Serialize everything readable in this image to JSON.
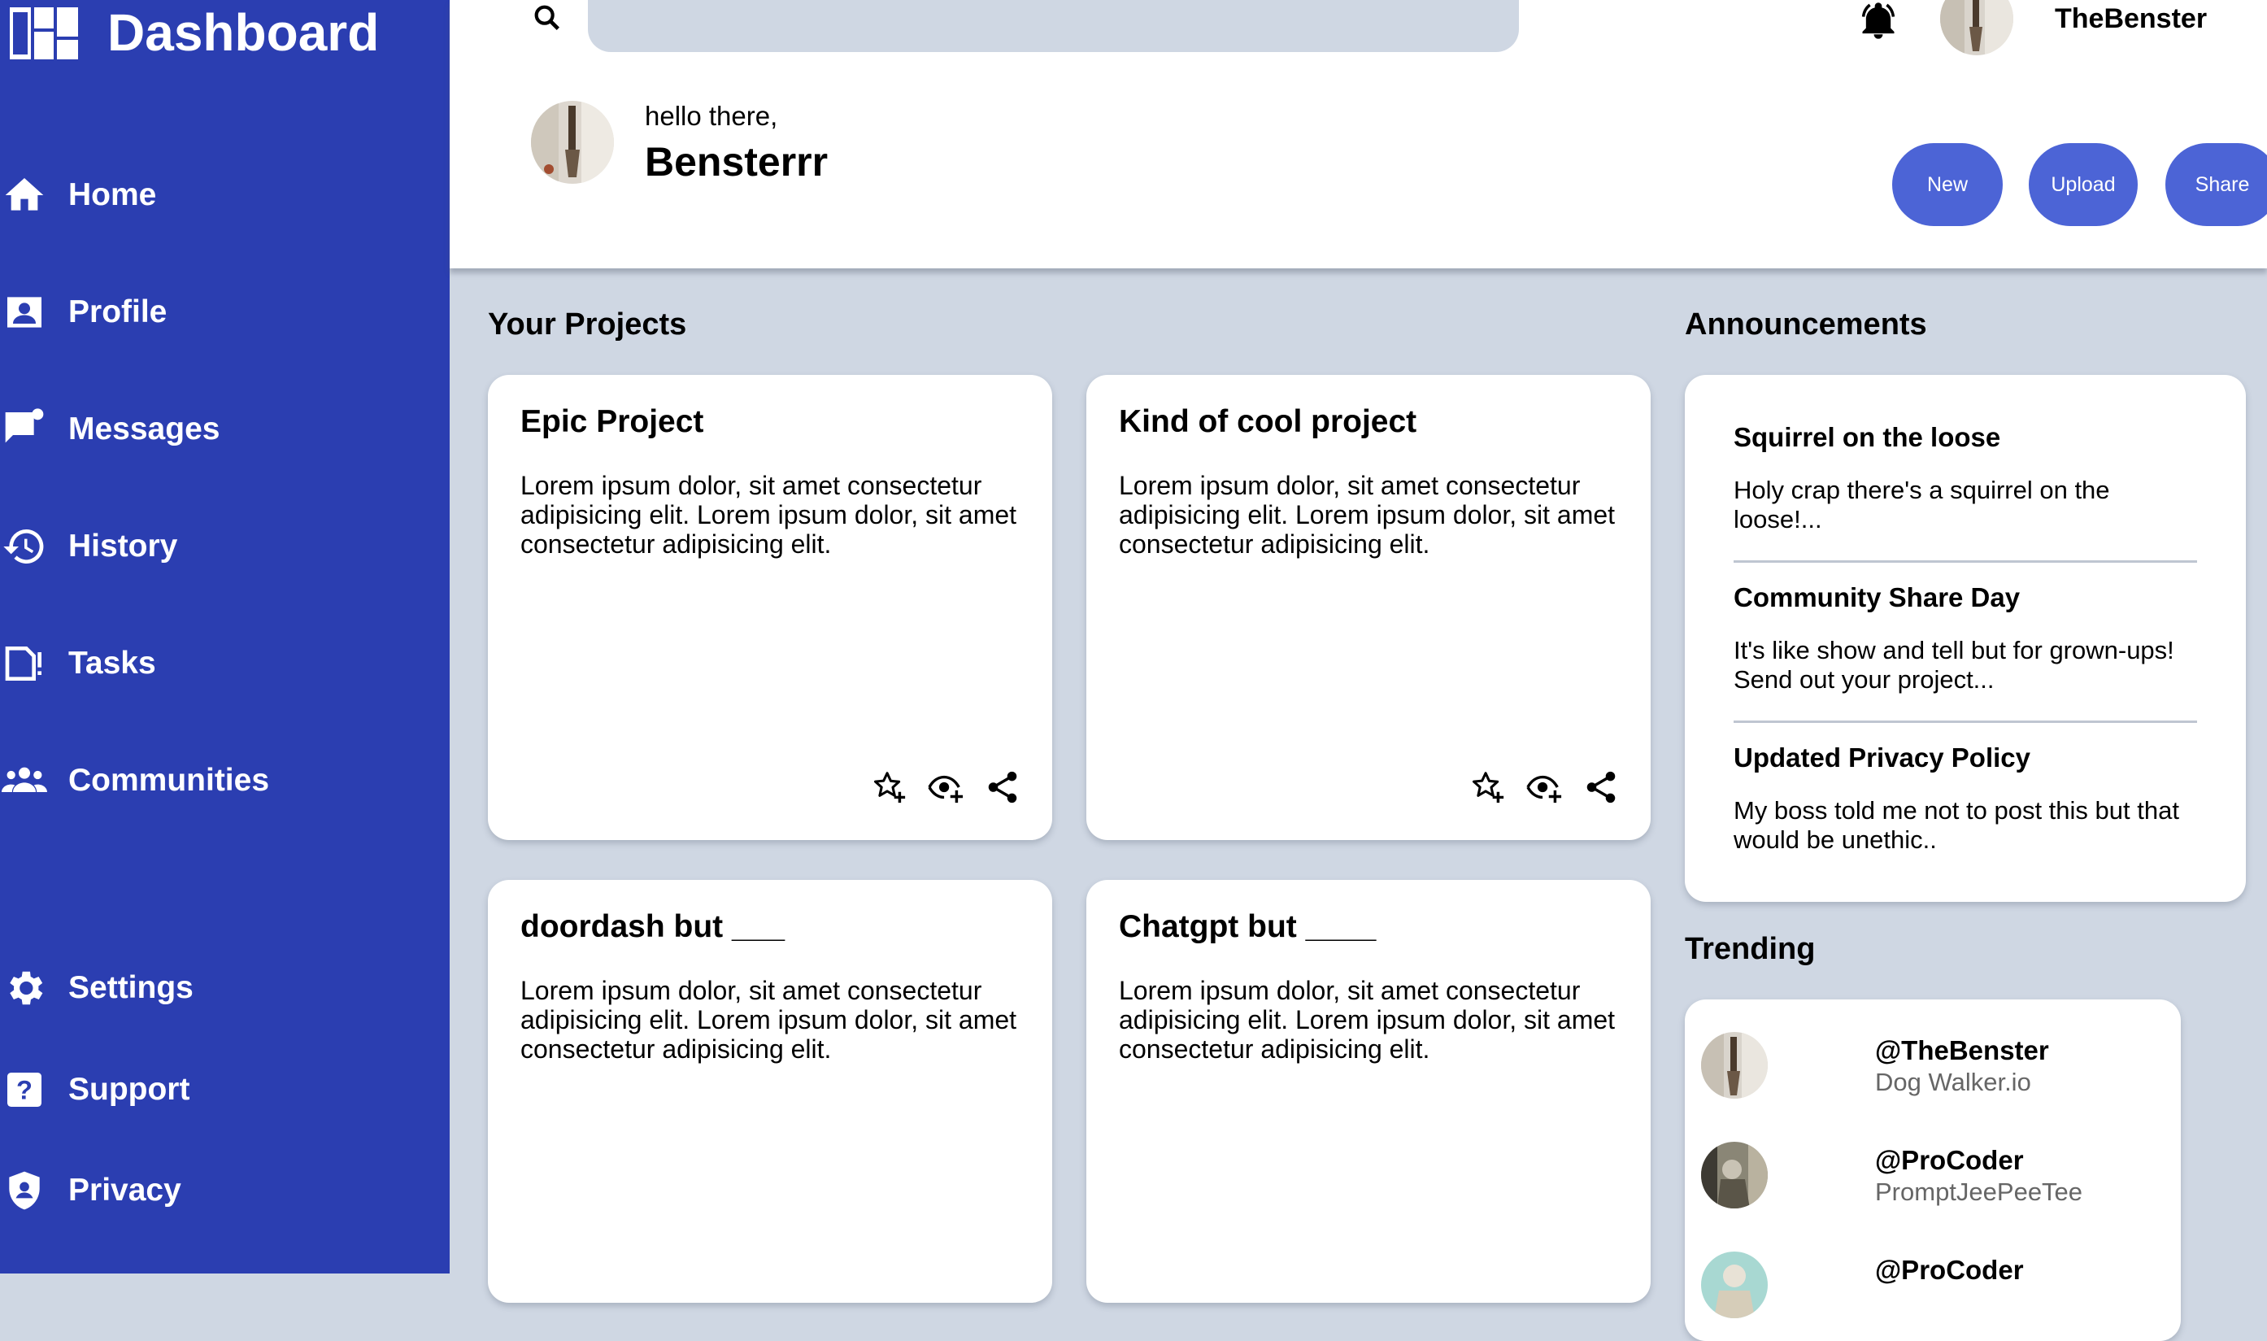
{
  "sidebar": {
    "brand": {
      "title": "Dashboard",
      "icon": "dashboard-grid-icon"
    },
    "items": [
      {
        "label": "Home",
        "icon": "home-icon"
      },
      {
        "label": "Profile",
        "icon": "profile-icon"
      },
      {
        "label": "Messages",
        "icon": "messages-icon"
      },
      {
        "label": "History",
        "icon": "history-icon"
      },
      {
        "label": "Tasks",
        "icon": "tasks-icon"
      },
      {
        "label": "Communities",
        "icon": "communities-icon"
      },
      {
        "label": "Settings",
        "icon": "gear-icon"
      },
      {
        "label": "Support",
        "icon": "support-icon"
      },
      {
        "label": "Privacy",
        "icon": "shield-icon"
      }
    ]
  },
  "header": {
    "search": {
      "placeholder": "",
      "value": ""
    },
    "username": "TheBenster",
    "greeting": "hello there,",
    "display_name": "Bensterrr",
    "buttons": {
      "new": "New",
      "upload": "Upload",
      "share": "Share"
    }
  },
  "projects": {
    "title": "Your Projects",
    "items": [
      {
        "title": "Epic Project",
        "body": "Lorem ipsum dolor, sit amet consectetur adipisicing elit. Lorem ipsum dolor, sit amet consectetur adipisicing elit."
      },
      {
        "title": "Kind of cool project",
        "body": "Lorem ipsum dolor, sit amet consectetur adipisicing elit. Lorem ipsum dolor, sit amet consectetur adipisicing elit."
      },
      {
        "title": "doordash but ___",
        "body": "Lorem ipsum dolor, sit amet consectetur adipisicing elit. Lorem ipsum dolor, sit amet consectetur adipisicing elit."
      },
      {
        "title": "Chatgpt but ____",
        "body": "Lorem ipsum dolor, sit amet consectetur adipisicing elit. Lorem ipsum dolor, sit amet consectetur adipisicing elit."
      }
    ]
  },
  "announcements": {
    "title": "Announcements",
    "items": [
      {
        "title": "Squirrel on the loose",
        "body": "Holy crap there's a squirrel on the loose!..."
      },
      {
        "title": "Community Share Day",
        "body": "It's like show and tell but for grown-ups! Send out your project..."
      },
      {
        "title": "Updated Privacy Policy",
        "body": "My boss told me not to post this but that would be unethic.."
      }
    ]
  },
  "trending": {
    "title": "Trending",
    "items": [
      {
        "handle": "@TheBenster",
        "project": "Dog Walker.io"
      },
      {
        "handle": "@ProCoder",
        "project": "PromptJeePeeTee"
      },
      {
        "handle": "@ProCoder",
        "project": ""
      }
    ]
  },
  "colors": {
    "sidebar": "#2b3eb1",
    "accent_button": "#4c64d6",
    "background": "#cfd7e3"
  }
}
